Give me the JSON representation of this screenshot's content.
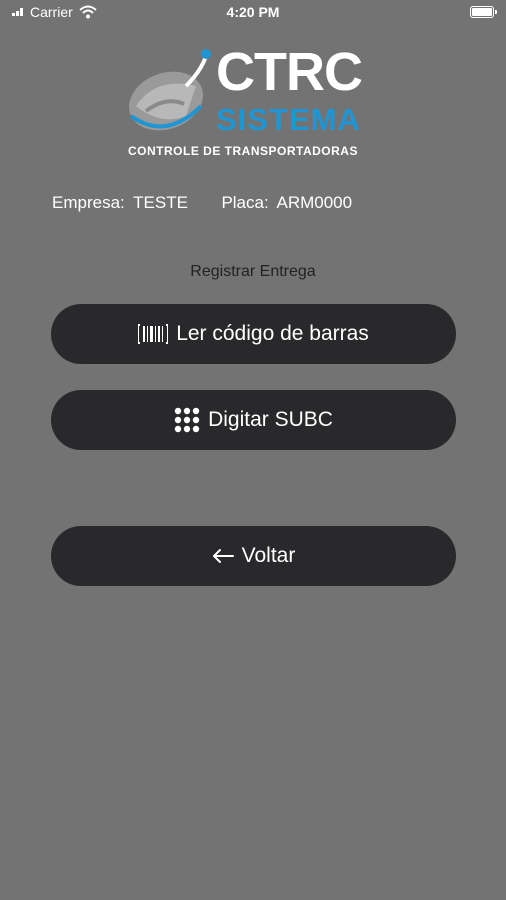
{
  "status_bar": {
    "carrier": "Carrier",
    "time": "4:20 PM",
    "icons": [
      "signal-icon",
      "wifi-icon",
      "battery-icon"
    ]
  },
  "logo": {
    "title": "CTRC",
    "subtitle": "SISTEMA",
    "tagline": "CONTROLE DE TRANSPORTADORAS",
    "accent_color": "#1f95d4"
  },
  "info": {
    "empresa_label": "Empresa:",
    "empresa_value": "TESTE",
    "placa_label": "Placa:",
    "placa_value": "ARM0000"
  },
  "section": {
    "title": "Registrar Entrega"
  },
  "actions": {
    "barcode_label": "Ler código de barras",
    "barcode_icon": "barcode-icon",
    "subc_label": "Digitar SUBC",
    "subc_icon": "keypad-icon",
    "back_label": "Voltar",
    "back_icon": "arrow-left-icon"
  },
  "colors": {
    "background": "#737373",
    "button": "#29292b"
  }
}
